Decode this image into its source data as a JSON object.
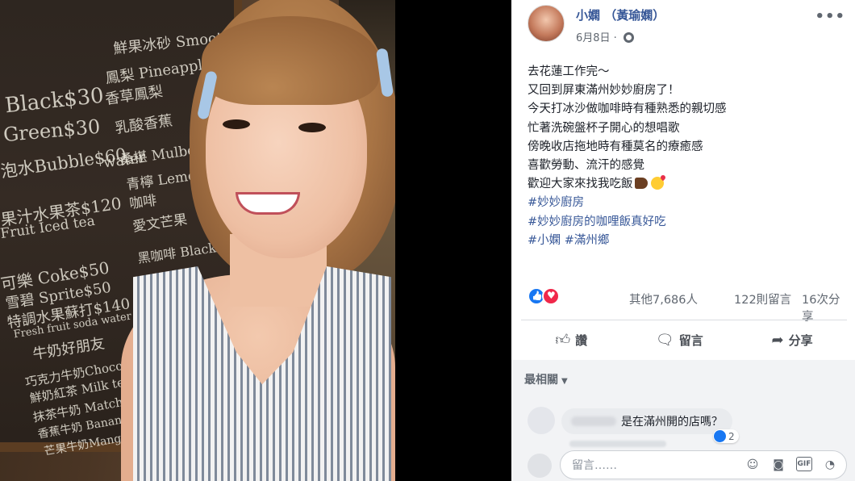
{
  "photo": {
    "chalk_lines": [
      "Black$30",
      "Green$30",
      "泡水Bubble$60",
      "water",
      "果汁水果茶$120",
      "Fruit Iced tea",
      "可樂 Coke$50",
      "雪碧 Sprite$50",
      "特調水果蘇打$140",
      "Fresh fruit soda water",
      "牛奶好朋友",
      "巧克力牛奶Chocolate",
      "鮮奶紅茶 Milk tea",
      "抹茶牛奶 Matcha",
      "香蕉牛奶 Banana",
      "芒果牛奶Mango",
      "鳳梨 Pineapple",
      "香草鳳梨",
      "乳酸香蕉",
      "桑椹 Mulberry",
      "青檸 Lemon",
      "咖啡",
      "愛文芒果",
      "鮮果冰砂 Smoothie",
      "黑咖啡 Black"
    ]
  },
  "post": {
    "author": "小嫻 （黃瑜嫻）",
    "date": "6月8日",
    "more_label": "•••",
    "lines": [
      "去花蓮工作完～",
      "又回到屏東滿州妙妙廚房了！",
      "今天打冰沙做咖啡時有種熟悉的親切感",
      "忙著洗碗盤杯子開心的想唱歌",
      "傍晚收店拖地時有種莫名的療癒感",
      "喜歡勞動、流汗的感覺",
      "歡迎大家來找我吃飯"
    ],
    "hashtags": [
      "#妙妙廚房",
      "#妙妙廚房的咖哩飯真好吃",
      "#小嫻",
      "#滿州鄉"
    ]
  },
  "stats": {
    "others": "其他7,686人",
    "comments": "122則留言",
    "shares": "16次分享"
  },
  "actions": {
    "like": "讚",
    "comment": "留言",
    "share": "分享"
  },
  "comments": {
    "sort_label": "最相關",
    "first_comment_text": "是在滿州開的店嗎？",
    "first_comment_reactions": "2",
    "composer_placeholder": "留言……"
  },
  "colors": {
    "link": "#385898",
    "like": "#1877f2",
    "love": "#f0284a"
  }
}
